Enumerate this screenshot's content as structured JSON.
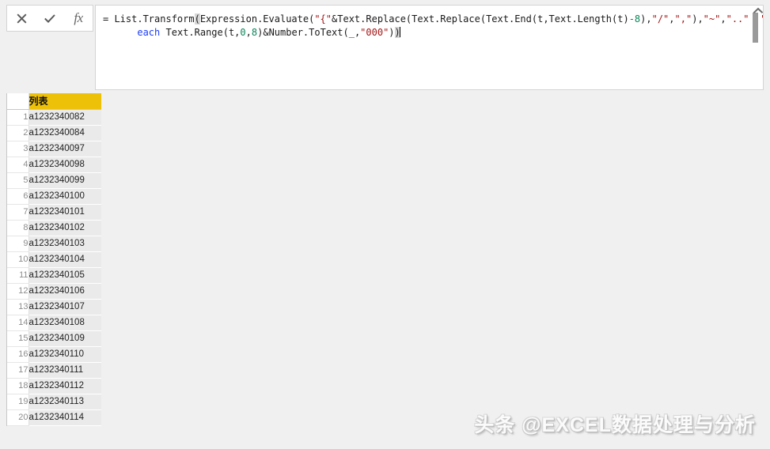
{
  "formula_bar": {
    "cancel_label": "cancel-edit",
    "accept_label": "accept-edit",
    "fx_label": "fx",
    "formula_line1_prefix": "= List.Transform",
    "formula_full": "= List.Transform(Expression.Evaluate(\"{\"&Text.Replace(Text.Replace(Text.End(t,Text.Length(t)-8),\"/\",\",\"),\"~\",\"..\")&\"}\"),\n      each Text.Range(t,0,8)&Number.ToText(_,\"000\"))",
    "line1": {
      "t1": "= List.Transform",
      "p1": "(",
      "t2": "Expression.Evaluate(",
      "s1": "\"{\"",
      "t3": "&Text.Replace(Text.Replace(Text.End(t,Text.Length(t)",
      "n1": "-8",
      "t4": "),",
      "s2": "\"/\"",
      "t5": ",",
      "s3": "\",\"",
      "t6": "),",
      "s4": "\"~\"",
      "t7": ",",
      "s5": "\"..\"",
      "t8": ")&",
      "s6": "\"}\"",
      "t9": "),"
    },
    "line2": {
      "indent": "      ",
      "kw": "each",
      "t1": " Text.Range(t,",
      "n1": "0",
      "t2": ",",
      "n2": "8",
      "t3": ")&Number.ToText(_,",
      "s1": "\"000\"",
      "t4": ")",
      "p1": ")"
    },
    "collapse_icon": "chevron-up-icon"
  },
  "grid": {
    "column_header": "列表",
    "rows": [
      {
        "index": "1",
        "value": "a1232340082"
      },
      {
        "index": "2",
        "value": "a1232340084"
      },
      {
        "index": "3",
        "value": "a1232340097"
      },
      {
        "index": "4",
        "value": "a1232340098"
      },
      {
        "index": "5",
        "value": "a1232340099"
      },
      {
        "index": "6",
        "value": "a1232340100"
      },
      {
        "index": "7",
        "value": "a1232340101"
      },
      {
        "index": "8",
        "value": "a1232340102"
      },
      {
        "index": "9",
        "value": "a1232340103"
      },
      {
        "index": "10",
        "value": "a1232340104"
      },
      {
        "index": "11",
        "value": "a1232340105"
      },
      {
        "index": "12",
        "value": "a1232340106"
      },
      {
        "index": "13",
        "value": "a1232340107"
      },
      {
        "index": "14",
        "value": "a1232340108"
      },
      {
        "index": "15",
        "value": "a1232340109"
      },
      {
        "index": "16",
        "value": "a1232340110"
      },
      {
        "index": "17",
        "value": "a1232340111"
      },
      {
        "index": "18",
        "value": "a1232340112"
      },
      {
        "index": "19",
        "value": "a1232340113"
      },
      {
        "index": "20",
        "value": "a1232340114"
      }
    ]
  },
  "watermark": {
    "text": "头条 @EXCEL数据处理与分析"
  },
  "colors": {
    "header_yellow": "#eec109",
    "string_red": "#a31515",
    "number_green": "#098658",
    "keyword_blue": "#1d3df5",
    "cell_gray": "#eaeaea",
    "app_background": "#f0f0f0"
  }
}
